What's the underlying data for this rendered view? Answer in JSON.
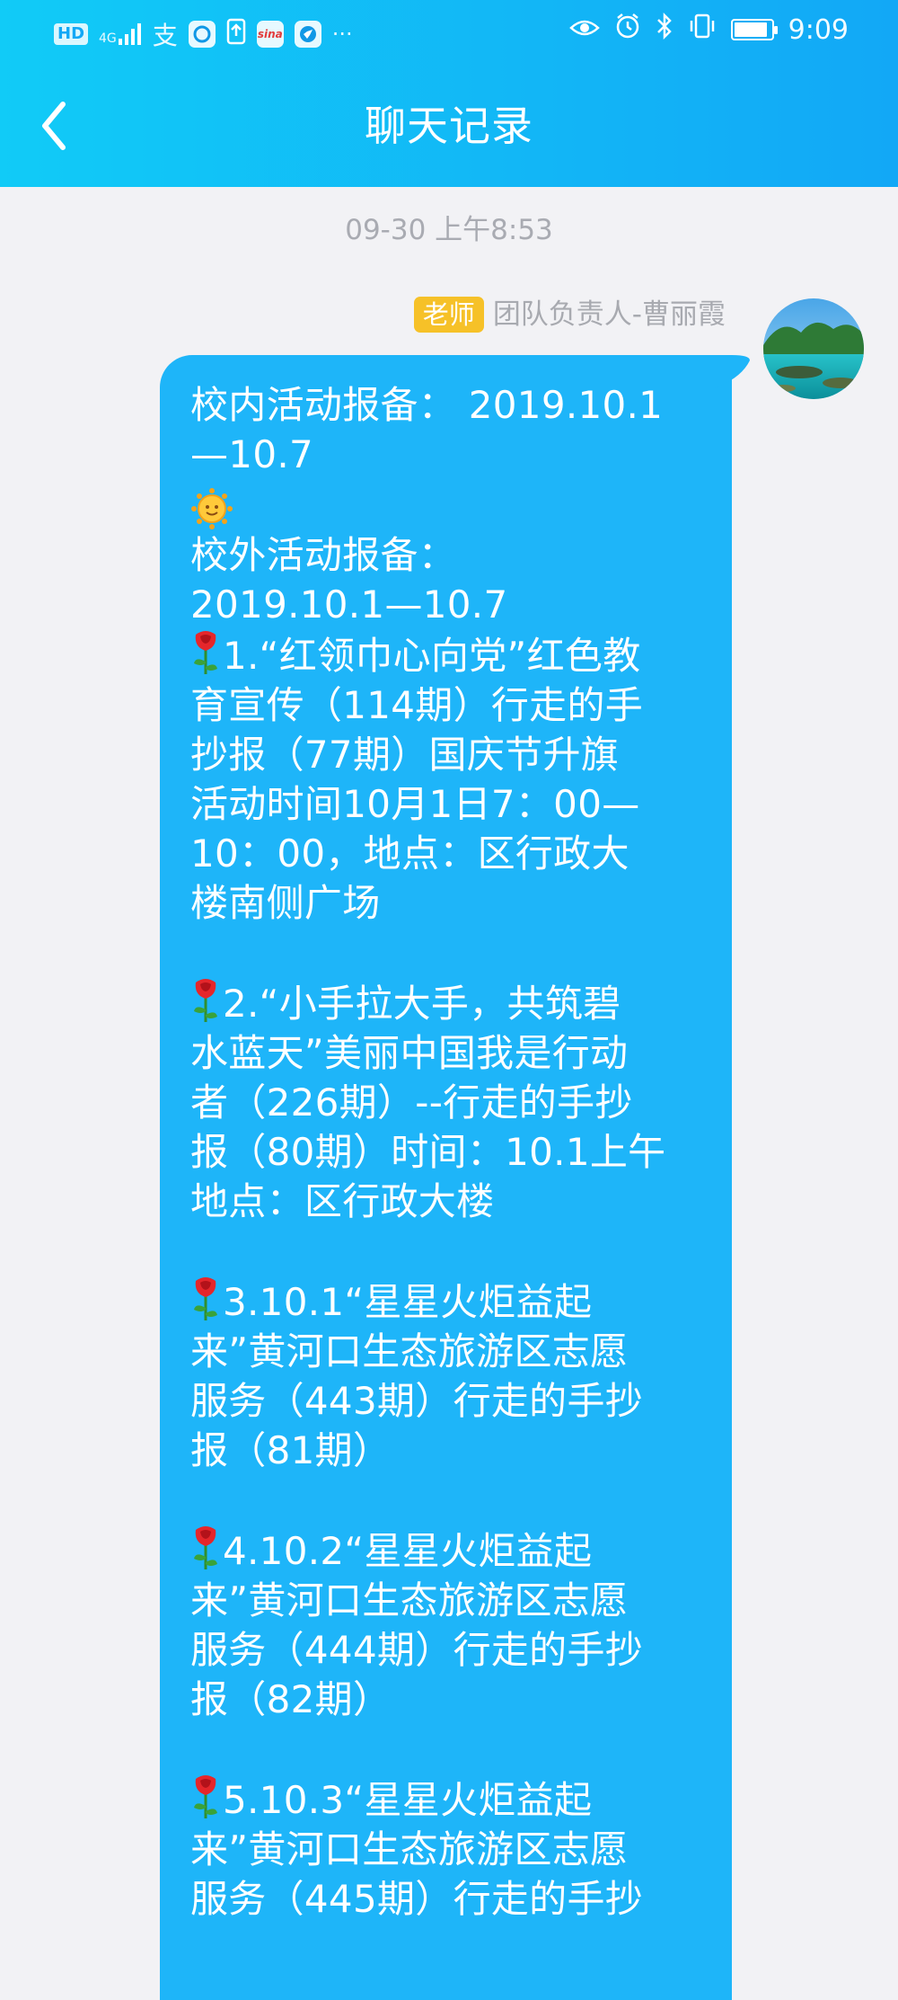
{
  "status_bar": {
    "left_icons": [
      "hd-icon",
      "signal-4g-icon",
      "alipay-icon",
      "qq-browser-icon",
      "upload-icon",
      "sina-weibo-icon",
      "app-icon",
      "more-dots-icon"
    ],
    "hd_label": "HD",
    "network_label": "4G",
    "alipay_label": "支",
    "sina_label": "sina",
    "more_label": "···",
    "right_icons": [
      "eye-icon",
      "alarm-icon",
      "bluetooth-icon",
      "vibrate-icon",
      "battery-icon"
    ],
    "battery_level": 0.9,
    "time": "9:09"
  },
  "header": {
    "title": "聊天记录",
    "back_icon": "chevron-left-icon"
  },
  "chat": {
    "timestamp": "09-30 上午8:53",
    "sender": {
      "role_badge": "老师",
      "name": "团队负责人-曹丽霞"
    },
    "message": {
      "line1": "校内活动报备： 2019.10.1",
      "line2": "—10.7",
      "line3": "校外活动报备：",
      "line4": "2019.10.1—10.7",
      "item1": [
        "1.“红领巾心向党”红色教",
        "育宣传（114期）行走的手",
        "抄报（77期）国庆节升旗",
        "活动时间10月1日7：00—",
        "10：00，地点：区行政大",
        "楼南侧广场"
      ],
      "item2": [
        "2.“小手拉大手，共筑碧",
        "水蓝天”美丽中国我是行动",
        "者（226期）--行走的手抄",
        "报（80期）时间：10.1上午",
        "地点：区行政大楼"
      ],
      "item3": [
        "3.10.1“星星火炬益起",
        "来”黄河口生态旅游区志愿",
        "服务（443期）行走的手抄",
        "报（81期）"
      ],
      "item4": [
        "4.10.2“星星火炬益起",
        "来”黄河口生态旅游区志愿",
        "服务（444期）行走的手抄",
        "报（82期）"
      ],
      "item5": [
        "5.10.3“星星火炬益起",
        "来”黄河口生态旅游区志愿",
        "服务（445期）行走的手抄"
      ]
    }
  },
  "colors": {
    "header_gradient_start": "#11cbf7",
    "header_gradient_end": "#12a8f6",
    "bubble": "#1eb5f9",
    "background": "#f2f2f5",
    "role_badge": "#f6c128",
    "muted_text": "#a8aab0"
  }
}
